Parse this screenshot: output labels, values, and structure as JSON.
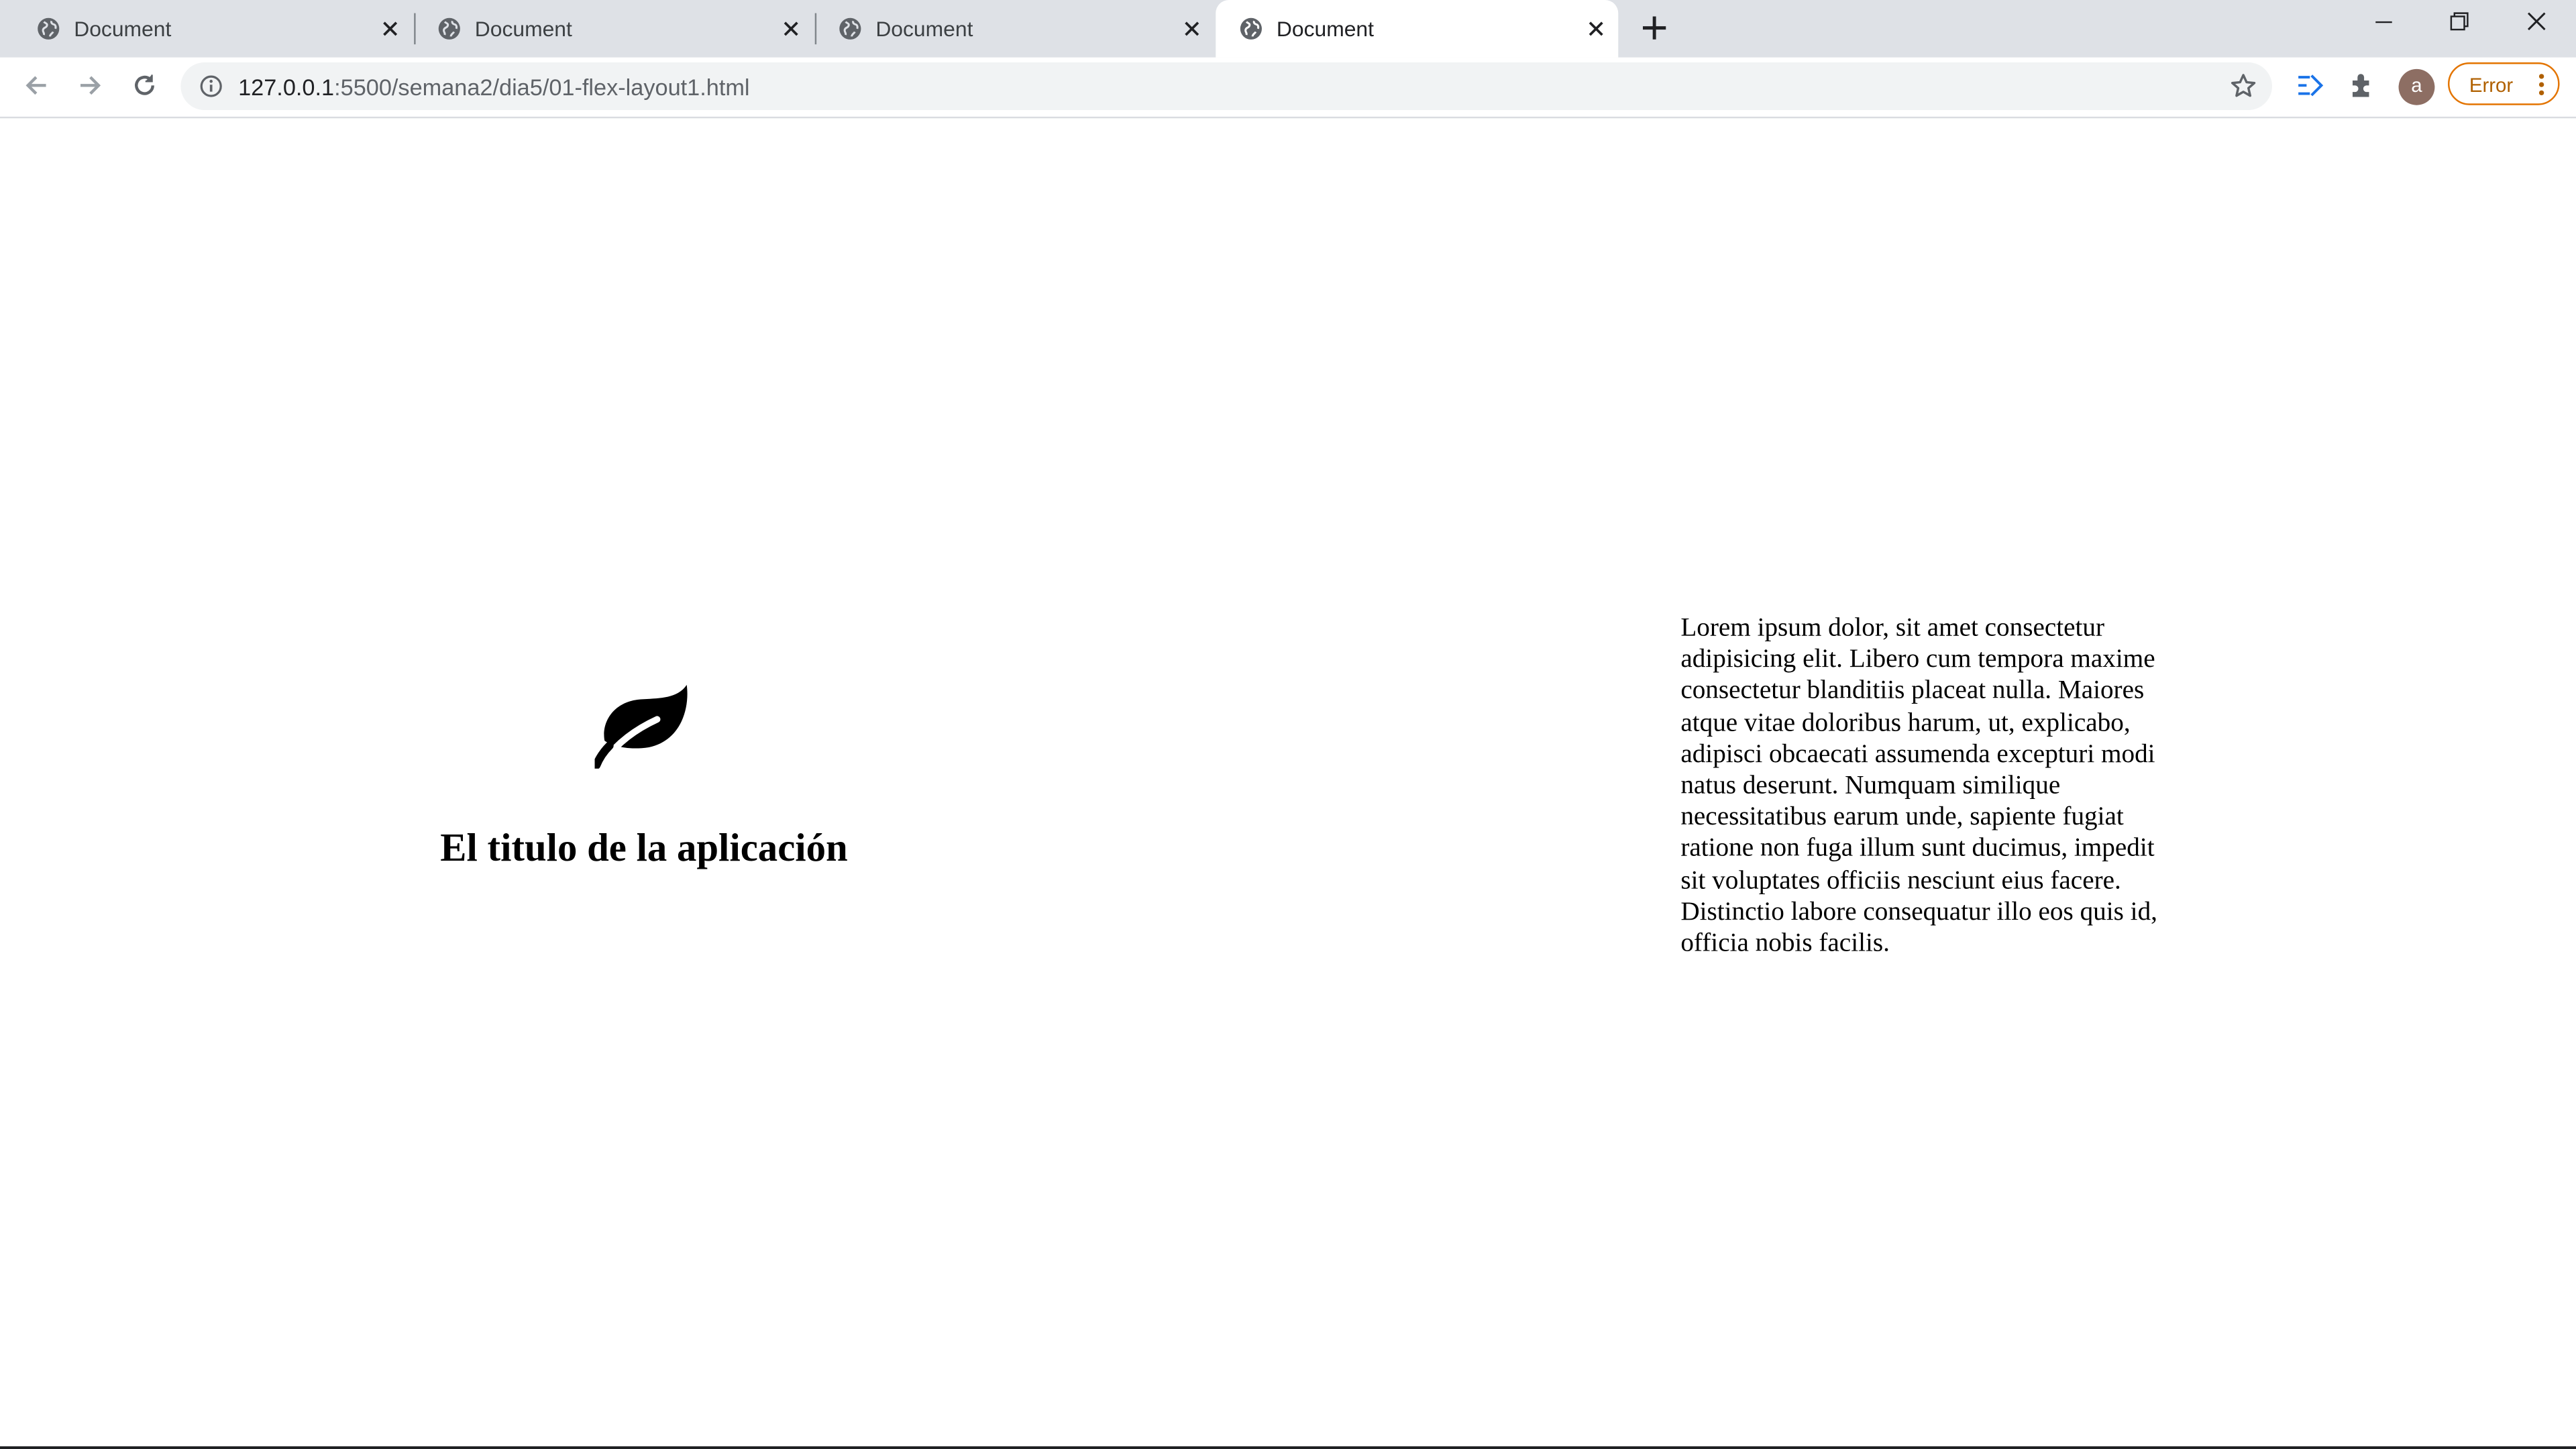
{
  "browser": {
    "tabs": [
      {
        "title": "Document",
        "active": false
      },
      {
        "title": "Document",
        "active": false
      },
      {
        "title": "Document",
        "active": false
      },
      {
        "title": "Document",
        "active": true
      }
    ],
    "address": {
      "host": "127.0.0.1",
      "rest": ":5500/semana2/dia5/01-flex-layout1.html"
    },
    "profile_initial": "a",
    "error_label": "Error",
    "icons": [
      "globe-icon",
      "close-icon",
      "plus-icon",
      "minimize-icon",
      "restore-icon",
      "back-icon",
      "forward-icon",
      "reload-icon",
      "info-icon",
      "star-icon",
      "reading-list-icon",
      "extensions-icon",
      "more-vert-icon"
    ]
  },
  "page": {
    "logo_icon": "leaf-icon",
    "app_title": "El titulo de la aplicación",
    "paragraph": "Lorem ipsum dolor, sit amet consectetur adipisicing elit. Libero cum tempora maxime consectetur blanditiis placeat nulla. Maiores atque vitae doloribus harum, ut, explicabo, adipisci obcaecati assumenda excepturi modi natus deserunt. Numquam similique necessitatibus earum unde, sapiente fugiat ratione non fuga illum sunt ducimus, impedit sit voluptates officiis nesciunt eius facere. Distinctio labore consequatur illo eos quis id, officia nobis facilis."
  },
  "colors": {
    "tabstrip": "#dee1e6",
    "omnibox": "#f1f3f4",
    "error_border": "#e37400",
    "avatar": "#8d6e63"
  }
}
